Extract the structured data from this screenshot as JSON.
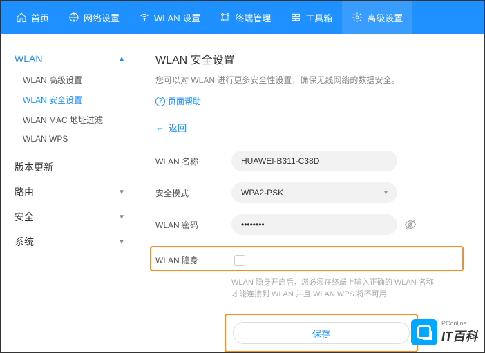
{
  "topnav": [
    {
      "label": "首页",
      "icon": "home"
    },
    {
      "label": "网络设置",
      "icon": "globe"
    },
    {
      "label": "WLAN 设置",
      "icon": "wifi"
    },
    {
      "label": "终端管理",
      "icon": "devices"
    },
    {
      "label": "工具箱",
      "icon": "toolbox"
    },
    {
      "label": "高级设置",
      "icon": "gear",
      "active": true
    }
  ],
  "sidebar": {
    "groups": [
      {
        "label": "WLAN",
        "expanded": true,
        "active": true,
        "items": [
          {
            "label": "WLAN 高级设置"
          },
          {
            "label": "WLAN 安全设置",
            "active": true
          },
          {
            "label": "WLAN MAC 地址过滤"
          },
          {
            "label": "WLAN WPS"
          }
        ]
      },
      {
        "label": "版本更新",
        "expanded": false
      },
      {
        "label": "路由",
        "expanded": false
      },
      {
        "label": "安全",
        "expanded": false
      },
      {
        "label": "系统",
        "expanded": false
      }
    ]
  },
  "page": {
    "title": "WLAN 安全设置",
    "desc": "您可以对 WLAN 进行更多安全性设置，确保无线网络的数据安全。",
    "help": "页面帮助",
    "back": "返回"
  },
  "form": {
    "wlan_name_label": "WLAN 名称",
    "wlan_name_value": "HUAWEI-B311-C38D",
    "sec_mode_label": "安全模式",
    "sec_mode_value": "WPA2-PSK",
    "wlan_pwd_label": "WLAN 密码",
    "wlan_pwd_value": "••••••••",
    "wlan_hide_label": "WLAN 隐身",
    "hint": "WLAN 隐身开启后，您必须在终端上输入正确的 WLAN 名称才能连接到 WLAN 并且 WLAN WPS 将不可用",
    "save": "保存"
  },
  "watermark": {
    "main": "IT百科",
    "sub": "PConline"
  }
}
